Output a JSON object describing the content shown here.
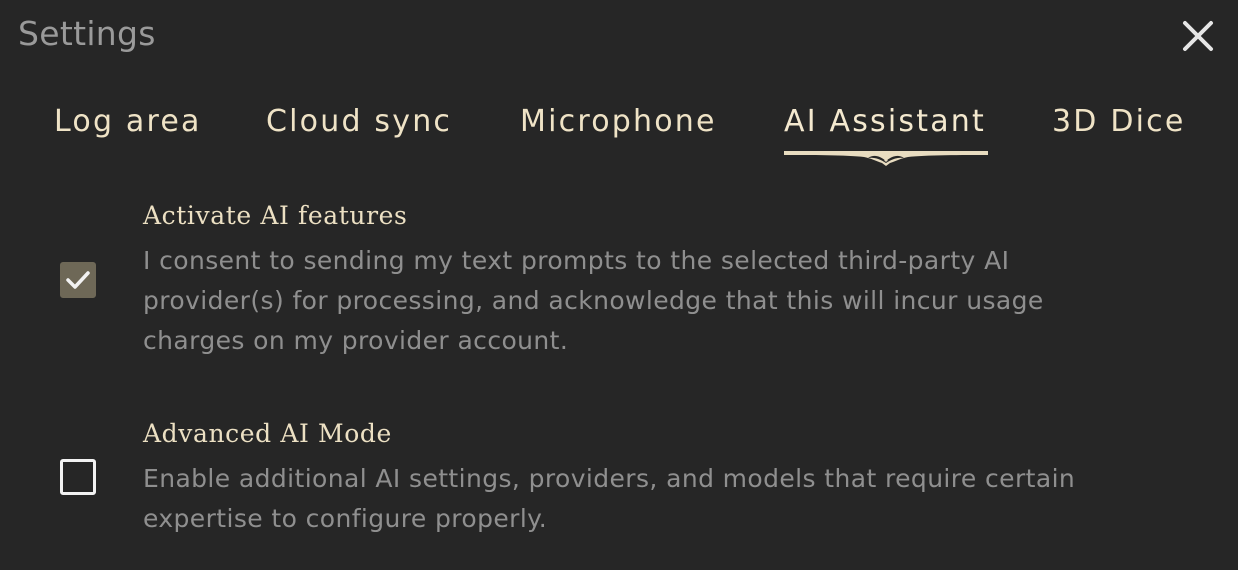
{
  "dialog": {
    "title": "Settings",
    "close_icon": "close-icon"
  },
  "tabs": [
    {
      "label": "Log area",
      "active": false
    },
    {
      "label": "Cloud sync",
      "active": false
    },
    {
      "label": "Microphone",
      "active": false
    },
    {
      "label": "AI Assistant",
      "active": true
    },
    {
      "label": "3D Dice",
      "active": false
    }
  ],
  "options": [
    {
      "title": "Activate AI features",
      "description": "I consent to sending my text prompts to the selected third-party AI provider(s) for processing, and acknowledge that this will incur usage charges on my provider account.",
      "checked": true
    },
    {
      "title": "Advanced AI Mode",
      "description": "Enable additional AI settings, providers, and models that require certain expertise to configure properly.",
      "checked": false
    }
  ],
  "colors": {
    "background": "#262626",
    "accent": "#e8dcc0",
    "checkbox_checked": "#6e6857"
  }
}
